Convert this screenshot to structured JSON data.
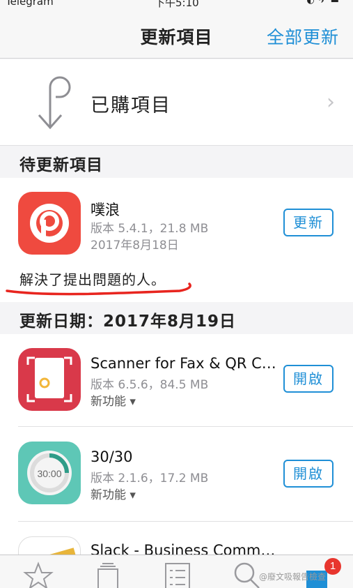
{
  "status_bar": {
    "carrier": "Telegram",
    "time": "下午5:10"
  },
  "nav": {
    "title": "更新項目",
    "update_all": "全部更新"
  },
  "purchased": {
    "label": "已購項目"
  },
  "pending": {
    "header": "待更新項目",
    "app": {
      "name": "噗浪",
      "version": "版本 5.4.1，21.8 MB",
      "date": "2017年8月18日",
      "button": "更新",
      "release_note": "解決了提出問題的人。",
      "icon": "plurk-p-icon",
      "icon_color": "#ef4a3f"
    }
  },
  "updated": {
    "header": "更新日期：2017年8月19日",
    "apps": [
      {
        "name": "Scanner for Fax & QR Code",
        "version": "版本 6.5.6，84.5 MB",
        "features": "新功能 ▾",
        "button": "開啟",
        "icon": "scanner-document-icon",
        "icon_color": "#d9394a"
      },
      {
        "name": "30/30",
        "version": "版本 2.1.6，17.2 MB",
        "features": "新功能 ▾",
        "button": "開啟",
        "icon": "timer-ring-icon",
        "icon_color": "#5ec7b6"
      },
      {
        "name": "Slack - Business Communication",
        "icon": "slack-icon"
      }
    ]
  },
  "tabbar": {
    "tabs": [
      {
        "icon": "featured-star-icon"
      },
      {
        "icon": "categories-icon"
      },
      {
        "icon": "top-charts-icon"
      },
      {
        "icon": "search-icon"
      },
      {
        "icon": "updates-icon",
        "badge": "1",
        "active": true
      }
    ]
  },
  "watermark": "@廢文吸報告檢查"
}
